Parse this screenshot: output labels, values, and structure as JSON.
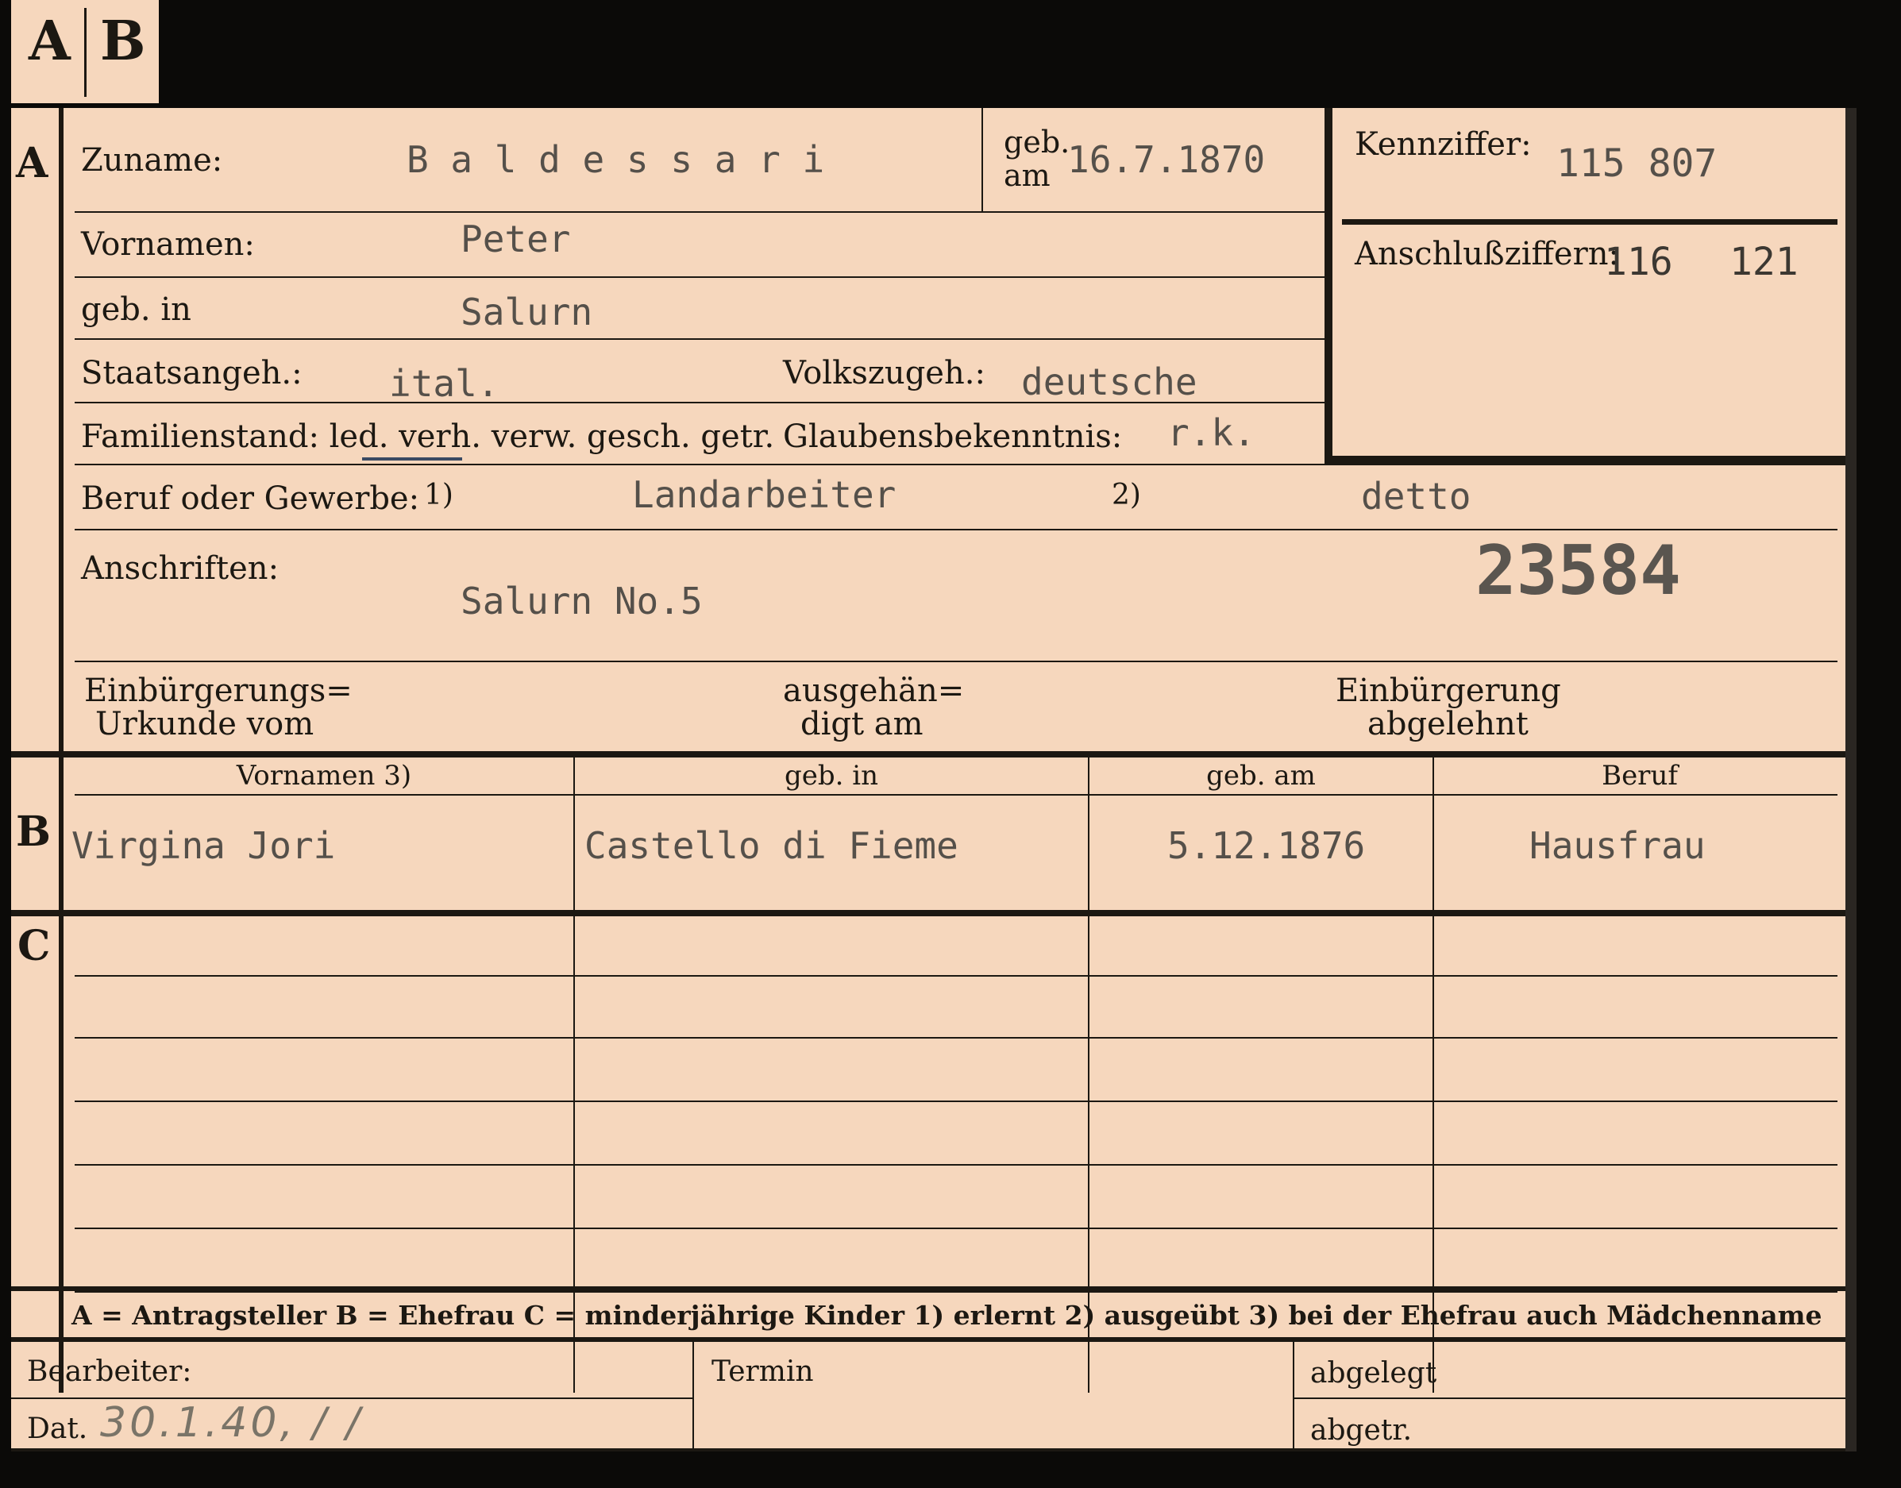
{
  "tab": {
    "a": "A",
    "b": "B"
  },
  "sections": {
    "a": "A",
    "b": "B",
    "c": "C"
  },
  "person": {
    "zuname_label": "Zuname:",
    "zuname_value": "B a l d e s s a r i",
    "geb_am_label_1": "geb.",
    "geb_am_label_2": "am",
    "geb_am_value": "16.7.1870",
    "vornamen_label": "Vornamen:",
    "vornamen_value": "Peter",
    "geb_in_label": "geb. in",
    "geb_in_value": "Salurn",
    "staatsangeh_label": "Staatsangeh.:",
    "staatsangeh_value": "ital.",
    "volkszugeh_label": "Volkszugeh.:",
    "volkszugeh_value": "deutsche",
    "familienstand_label": "Familienstand: led. verh. verw. gesch. getr.",
    "glaubens_label": "Glaubensbekenntnis:",
    "glaubens_value": "r.k.",
    "beruf_label": "Beruf oder Gewerbe:",
    "beruf_fn1": "1)",
    "beruf_value_1": "Landarbeiter",
    "beruf_fn2": "2)",
    "beruf_value_2": "detto",
    "anschriften_label": "Anschriften:",
    "anschriften_value": "Salurn No.5",
    "stamp_number": "23584"
  },
  "ids": {
    "kennziffer_label": "Kennziffer:",
    "kennziffer_value": "115 807",
    "anschluss_label": "Anschlußziffern:",
    "anschluss_value_1": "116",
    "anschluss_value_2": "121"
  },
  "einbuergerung": {
    "urkunde_1": "Einbürgerungs=",
    "urkunde_2": "Urkunde vom",
    "ausgehaendigt_1": "ausgehän=",
    "ausgehaendigt_2": "digt am",
    "abgelehnt_1": "Einbürgerung",
    "abgelehnt_2": "abgelehnt"
  },
  "table": {
    "headers": [
      "Vornamen 3)",
      "geb. in",
      "geb. am",
      "Beruf"
    ],
    "spouse_row": [
      "Virgina Jori",
      "Castello di Fieme",
      "5.12.1876",
      "Hausfrau"
    ]
  },
  "legend": {
    "text": "A = Antragsteller   B = Ehefrau   C = minderjährige Kinder   1) erlernt   2) ausgeübt   3) bei der Ehefrau auch Mädchenname"
  },
  "footer": {
    "bearbeiter_label": "Bearbeiter:",
    "termin_label": "Termin",
    "abgelegt_label": "abgelegt",
    "dat_label": "Dat.",
    "dat_value": "30.1.40, /          /",
    "abgetr_label": "abgetr."
  }
}
